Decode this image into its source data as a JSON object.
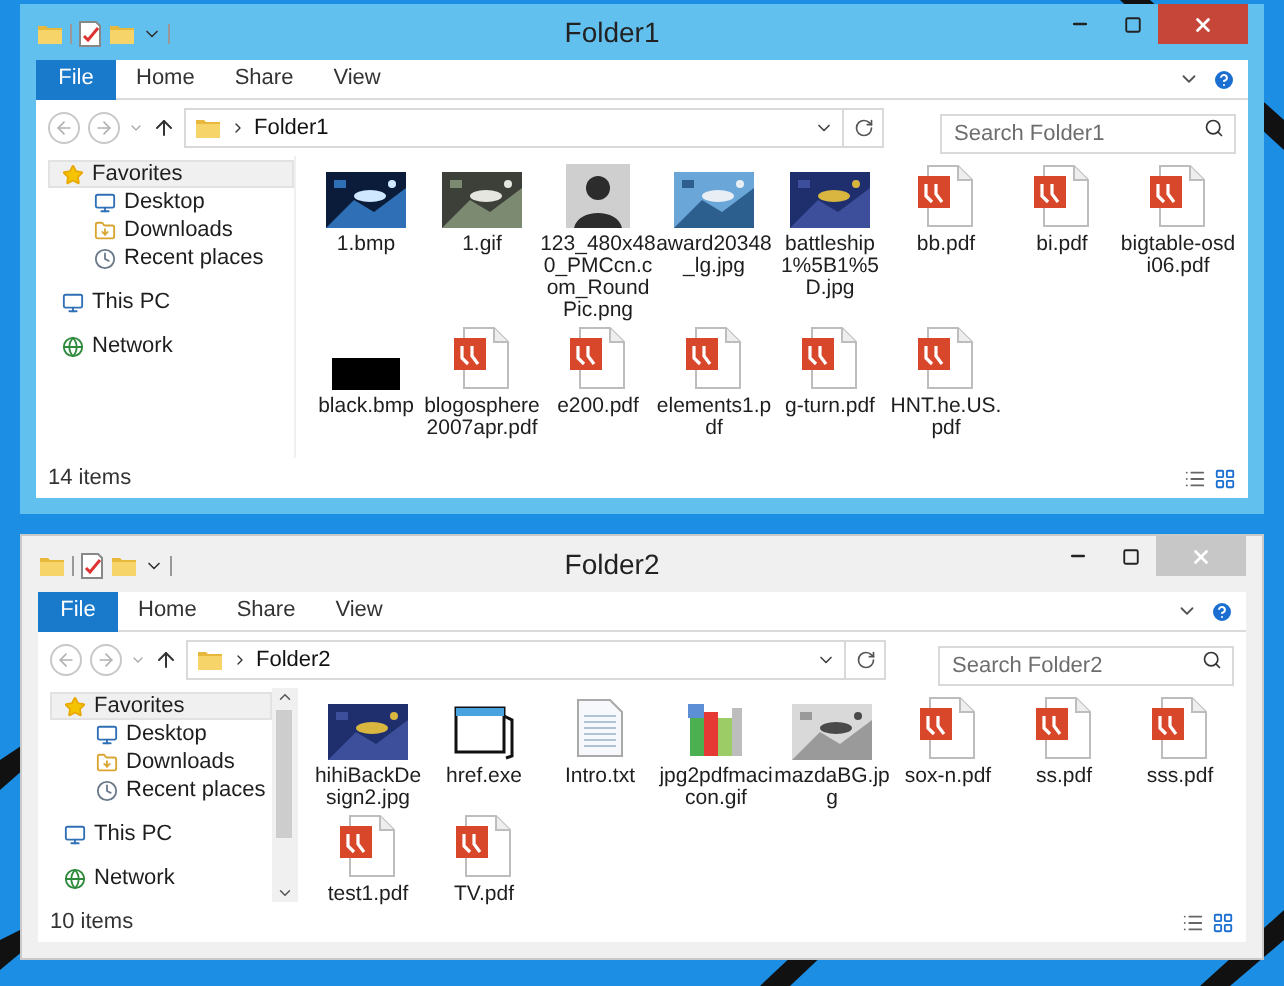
{
  "windows": [
    {
      "title": "Folder1",
      "active": true,
      "ribbon_tabs": [
        {
          "label": "File",
          "kind": "file"
        },
        {
          "label": "Home",
          "kind": "tab"
        },
        {
          "label": "Share",
          "kind": "tab"
        },
        {
          "label": "View",
          "kind": "tab"
        }
      ],
      "address": {
        "path": "Folder1"
      },
      "search": {
        "placeholder": "Search Folder1"
      },
      "nav_pane": {
        "scrollbar": false,
        "items": [
          {
            "label": "Favorites",
            "kind": "favorites",
            "selected": true,
            "children": [
              {
                "label": "Desktop",
                "kind": "desktop",
                "selected": false
              },
              {
                "label": "Downloads",
                "kind": "downloads",
                "selected": false
              },
              {
                "label": "Recent places",
                "kind": "recent",
                "selected": false
              }
            ]
          },
          {
            "label": "This PC",
            "kind": "pc",
            "selected": false
          },
          {
            "label": "Network",
            "kind": "network",
            "selected": false
          }
        ]
      },
      "files": [
        {
          "name": "1.bmp"
        },
        {
          "name": "1.gif"
        },
        {
          "name": "123_480x480_PMCcn.com_RoundPic.png",
          "kind": "avatar"
        },
        {
          "name": "award20348_lg.jpg"
        },
        {
          "name": "battleship1%5B1%5D.jpg"
        },
        {
          "name": "bb.pdf",
          "kind": "pdf"
        },
        {
          "name": "bi.pdf",
          "kind": "pdf"
        },
        {
          "name": "bigtable-osdi06.pdf",
          "kind": "pdf"
        },
        {
          "name": "black.bmp",
          "kind": "black"
        },
        {
          "name": "blogosphere2007apr.pdf",
          "kind": "pdf"
        },
        {
          "name": "e200.pdf",
          "kind": "pdf"
        },
        {
          "name": "elements1.pdf",
          "kind": "pdf"
        },
        {
          "name": "g-turn.pdf",
          "kind": "pdf"
        },
        {
          "name": "HNT.he.US.pdf",
          "kind": "pdf"
        }
      ],
      "status": "14 items"
    },
    {
      "title": "Folder2",
      "active": false,
      "ribbon_tabs": [
        {
          "label": "File",
          "kind": "file"
        },
        {
          "label": "Home",
          "kind": "tab"
        },
        {
          "label": "Share",
          "kind": "tab"
        },
        {
          "label": "View",
          "kind": "tab"
        }
      ],
      "address": {
        "path": "Folder2"
      },
      "search": {
        "placeholder": "Search Folder2"
      },
      "nav_pane": {
        "scrollbar": true,
        "items": [
          {
            "label": "Favorites",
            "kind": "favorites",
            "selected": true,
            "children": [
              {
                "label": "Desktop",
                "kind": "desktop",
                "selected": false
              },
              {
                "label": "Downloads",
                "kind": "downloads",
                "selected": false
              },
              {
                "label": "Recent places",
                "kind": "recent",
                "selected": false
              }
            ]
          },
          {
            "label": "This PC",
            "kind": "pc",
            "selected": false
          },
          {
            "label": "Network",
            "kind": "network",
            "selected": false
          }
        ]
      },
      "files": [
        {
          "name": "hihiBackDesign2.jpg"
        },
        {
          "name": "href.exe",
          "kind": "exe"
        },
        {
          "name": "Intro.txt",
          "kind": "text"
        },
        {
          "name": "jpg2pdfmacicon.gif",
          "kind": "books"
        },
        {
          "name": "mazdaBG.jpg"
        },
        {
          "name": "sox-n.pdf",
          "kind": "pdf"
        },
        {
          "name": "ss.pdf",
          "kind": "pdf"
        },
        {
          "name": "sss.pdf",
          "kind": "pdf"
        },
        {
          "name": "test1.pdf",
          "kind": "pdf"
        },
        {
          "name": "TV.pdf",
          "kind": "pdf"
        }
      ],
      "status": "10 items"
    }
  ]
}
